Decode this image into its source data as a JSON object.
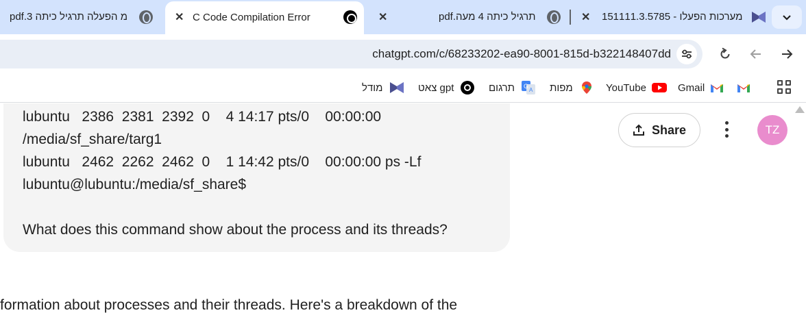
{
  "tabs": [
    {
      "title": "pdf.3 מ הפעלה תרגיל כיתה",
      "active": false
    },
    {
      "title": "C Code Compilation Error",
      "active": true
    },
    {
      "title": "pdf.תרגיל כיתה 4 מעה",
      "active": false
    },
    {
      "title": "151111.3.5785 - מערכות הפעלו",
      "active": false
    }
  ],
  "address_bar": {
    "url": "chatgpt.com/c/68233202-ea90-8001-815d-b322148407dd"
  },
  "bookmarks": [
    {
      "label": "מודל",
      "icon": "moodle-icon"
    },
    {
      "label": "צאט gpt",
      "icon": "chatgpt-icon"
    },
    {
      "label": "תרגום",
      "icon": "google-translate-icon"
    },
    {
      "label": "מפות",
      "icon": "google-maps-icon"
    },
    {
      "label": "YouTube",
      "icon": "youtube-icon"
    },
    {
      "label": "Gmail",
      "icon": "gmail-icon"
    },
    {
      "label": "",
      "icon": "gmail-icon"
    }
  ],
  "message": {
    "lines": [
      "lubuntu   2386  2381  2392  0    4 14:17 pts/0    00:00:00",
      "/media/sf_share/targ1",
      "lubuntu   2462  2262  2462  0    1 14:42 pts/0    00:00:00 ps -Lf",
      "lubuntu@lubuntu:/media/sf_share$"
    ],
    "question": "What does this command show about the process and its threads?"
  },
  "reply": "formation about processes and their threads. Here's a breakdown of the",
  "header": {
    "share_label": "Share",
    "avatar_initials": "TZ"
  },
  "colors": {
    "tabstrip": "#d3e3fd",
    "avatar": "#e98ccd",
    "bubble": "#f4f4f4"
  }
}
